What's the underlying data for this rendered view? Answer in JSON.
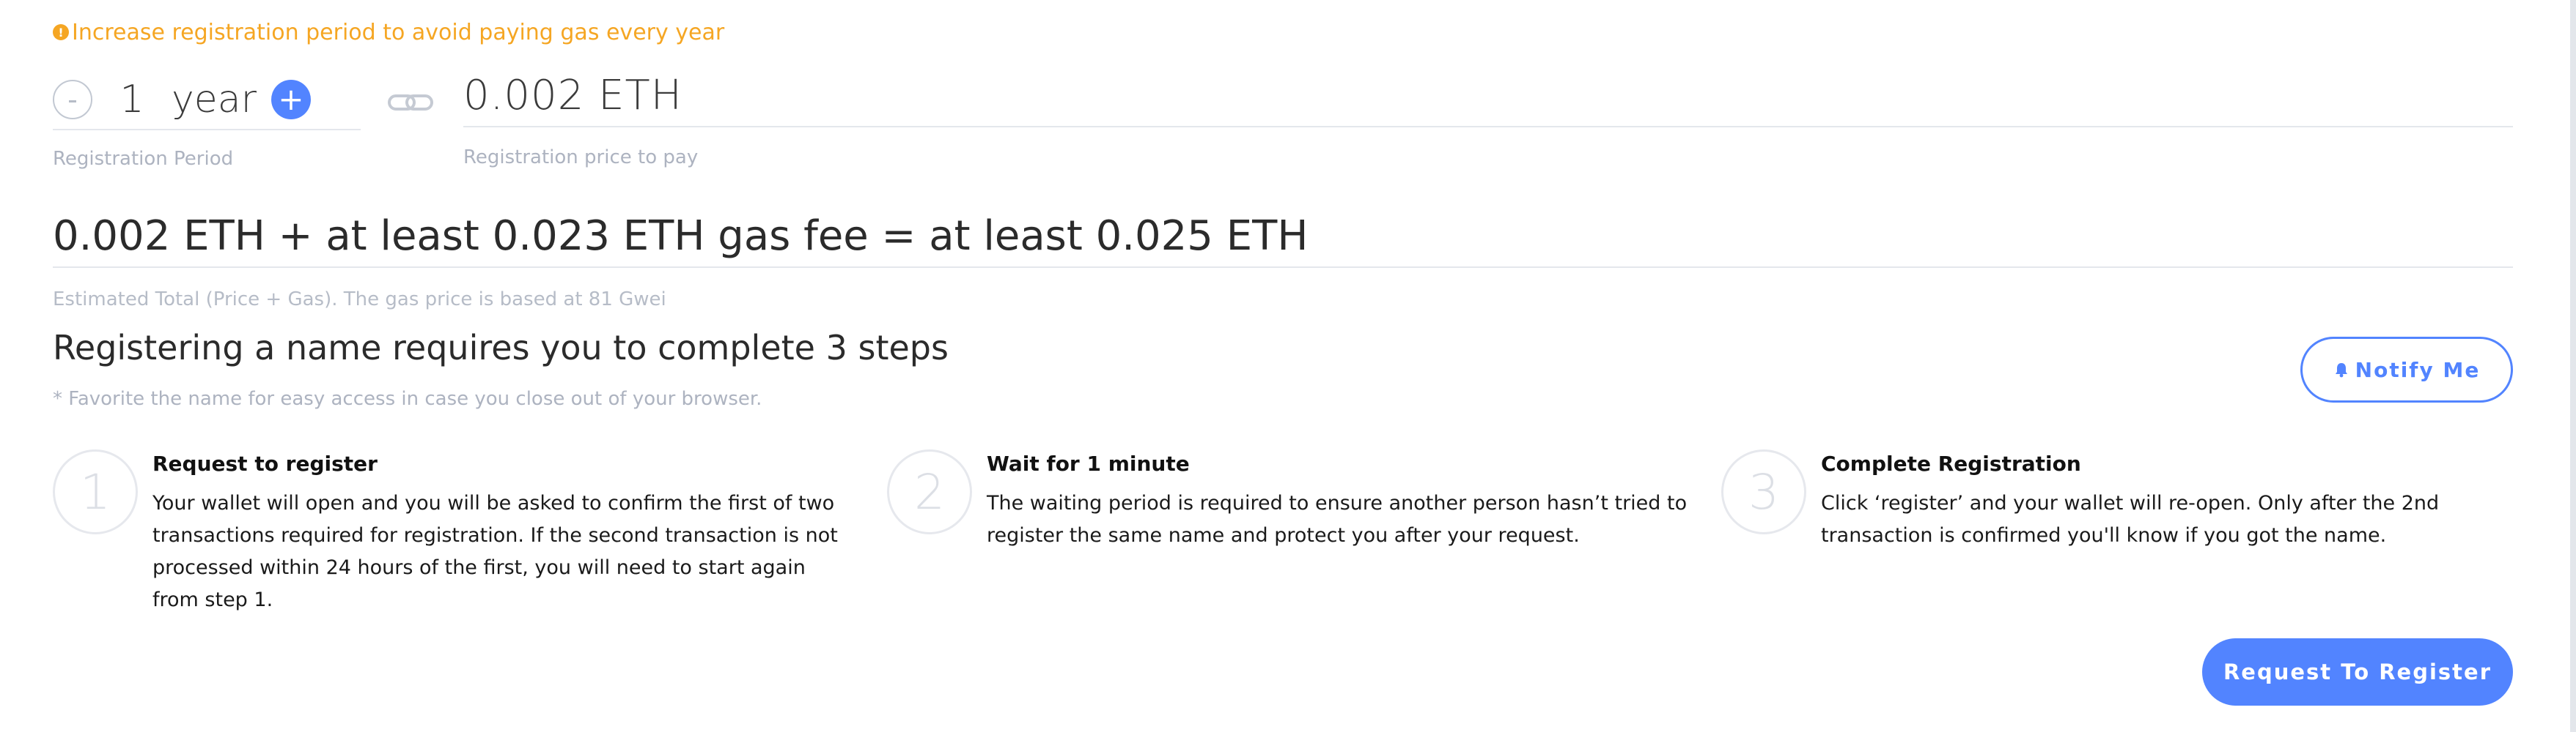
{
  "warning": {
    "text": "Increase registration period to avoid paying gas every year",
    "icon": "warning-icon",
    "color": "#f5a623"
  },
  "period": {
    "minus_label": "-",
    "value": "1",
    "unit": "year",
    "plus_label": "+",
    "label": "Registration Period"
  },
  "price": {
    "value": "0.002 ETH",
    "label": "Registration price to pay"
  },
  "total": {
    "value": "0.002 ETH + at least 0.023 ETH gas fee = at least 0.025 ETH",
    "label": "Estimated Total (Price + Gas). The gas price is based at 81 Gwei"
  },
  "steps_header": {
    "title": "Registering a name requires you to complete 3 steps",
    "note": "* Favorite the name for easy access in case you close out of your browser."
  },
  "notify": {
    "label": "Notify Me",
    "icon": "bell-icon"
  },
  "steps": [
    {
      "number": "1",
      "title": "Request to register",
      "text": "Your wallet will open and you will be asked to confirm the first of two transactions required for registration. If the second transaction is not processed within 24 hours of the first, you will need to start again from step 1."
    },
    {
      "number": "2",
      "title": "Wait for 1 minute",
      "text": "The waiting period is required to ensure another person hasn’t tried to register the same name and protect you after your request."
    },
    {
      "number": "3",
      "title": "Complete Registration",
      "text": "Click ‘register’ and your wallet will re-open. Only after the 2nd transaction is confirmed you'll know if you got the name."
    }
  ],
  "register_button": {
    "label": "Request To Register"
  },
  "colors": {
    "accent": "#5284ff",
    "warning": "#f5a623",
    "muted": "#adb3c0"
  }
}
